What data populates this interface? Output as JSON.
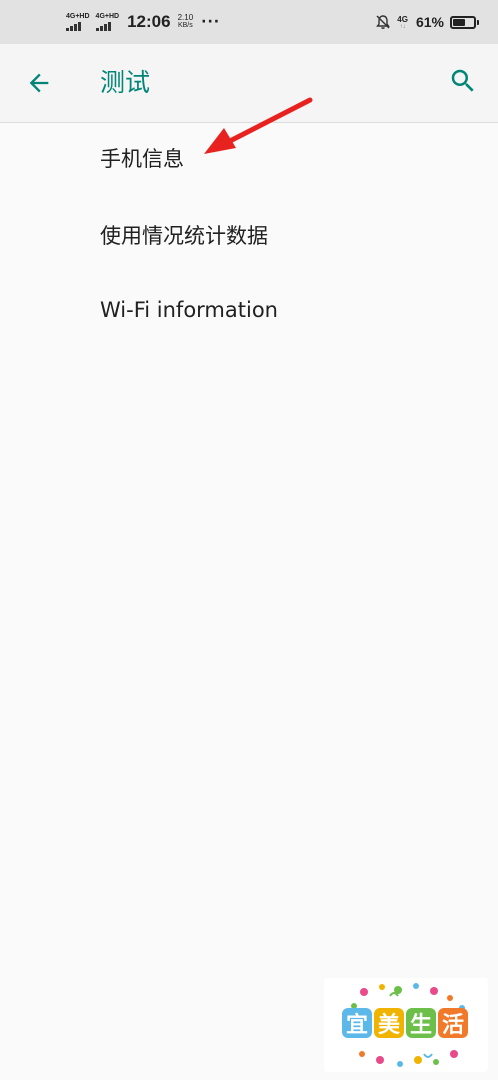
{
  "status_bar": {
    "network1": "4G+HD",
    "network2": "4G+HD",
    "time": "12:06",
    "speed_value": "2.10",
    "speed_unit": "KB/s",
    "more": "···",
    "network3": "4G",
    "network3_arrows": "↑↓",
    "battery_percent": "61%",
    "battery_level": 0.61,
    "icons": [
      "signal-icon",
      "signal-icon",
      "mute-bell-icon",
      "battery-icon"
    ]
  },
  "app_bar": {
    "back_icon": "arrow-left-icon",
    "title": "测试",
    "search_icon": "search-icon",
    "accent": "#008577"
  },
  "menu": {
    "items": [
      {
        "label": "手机信息"
      },
      {
        "label": "使用情况统计数据"
      },
      {
        "label": "Wi-Fi information"
      }
    ]
  },
  "annotation": {
    "arrow_color": "#e8231f"
  },
  "watermark": {
    "chars": [
      "宜",
      "美",
      "生",
      "活"
    ],
    "colors": [
      "#5bb8e8",
      "#f0b400",
      "#6cc04a",
      "#f07a2a"
    ]
  }
}
